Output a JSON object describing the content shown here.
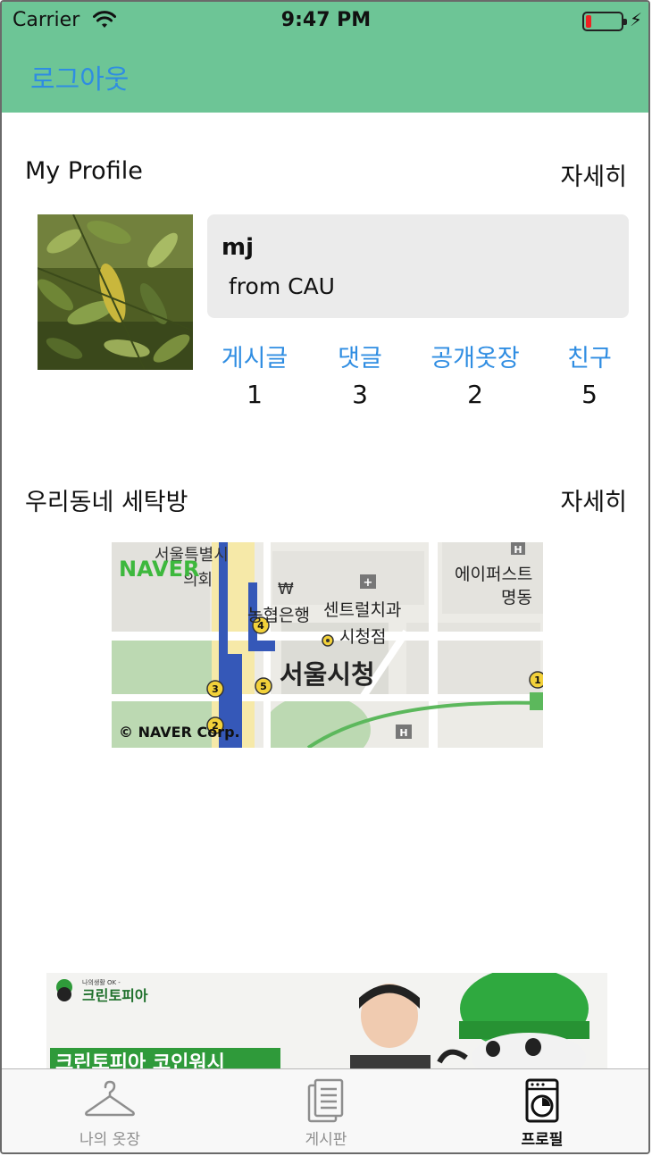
{
  "status_bar": {
    "carrier": "Carrier",
    "time": "9:47 PM"
  },
  "header": {
    "logout_label": "로그아웃"
  },
  "profile": {
    "section_title": "My Profile",
    "detail_label": "자세히",
    "name": "mj",
    "affiliation": "from CAU",
    "stats": [
      {
        "label": "게시글",
        "count": "1"
      },
      {
        "label": "댓글",
        "count": "3"
      },
      {
        "label": "공개옷장",
        "count": "2"
      },
      {
        "label": "친구",
        "count": "5"
      }
    ]
  },
  "laundry": {
    "section_title": "우리동네 세탁방",
    "detail_label": "자세히",
    "map": {
      "logo": "NAVER",
      "copyright": "© NAVER Corp.",
      "labels": [
        "서울특별시",
        "의회",
        "₩",
        "농협은행",
        "센트럴치과",
        "시청점",
        "서울시청",
        "에이퍼스트",
        "명동"
      ],
      "station_numbers": [
        "4",
        "3",
        "5",
        "2",
        "1"
      ]
    }
  },
  "ad": {
    "brand": "크린토피아",
    "tagline": "나의생활 OK -",
    "headline": "크린토피아 코인워시"
  },
  "tabbar": {
    "items": [
      {
        "label": "나의 옷장",
        "icon": "hanger-icon"
      },
      {
        "label": "게시판",
        "icon": "document-icon"
      },
      {
        "label": "프로필",
        "icon": "washing-machine-icon"
      }
    ]
  },
  "colors": {
    "header_bg": "#6dc596",
    "accent_blue": "#2f8de2",
    "tab_active": "#111111",
    "tab_inactive": "#8e8e8e"
  }
}
